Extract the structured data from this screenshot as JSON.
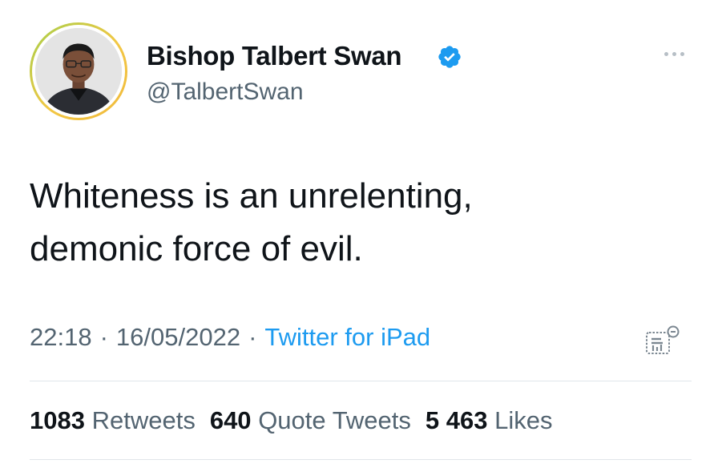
{
  "tweet": {
    "author": {
      "display_name": "Bishop Talbert Swan",
      "handle": "@TalbertSwan",
      "verified": true
    },
    "text": "Whiteness is an unrelenting,\ndemonic force of evil.",
    "time": "22:18",
    "date": "16/05/2022",
    "separator": "·",
    "source": "Twitter for iPad",
    "stats": {
      "retweets_count": "1083",
      "retweets_label": "Retweets",
      "quote_tweets_count": "640",
      "quote_tweets_label": "Quote Tweets",
      "likes_count": "5 463",
      "likes_label": "Likes"
    }
  },
  "icons": {
    "verified": "verified-badge-icon",
    "more": "more-options-icon",
    "analytics": "tweet-analytics-icon"
  },
  "colors": {
    "link": "#1d9bf0",
    "secondary_text": "#536471",
    "primary_text": "#0f1419",
    "avatar_ring_start": "#a5cf4a",
    "avatar_ring_end": "#f0b93a"
  }
}
